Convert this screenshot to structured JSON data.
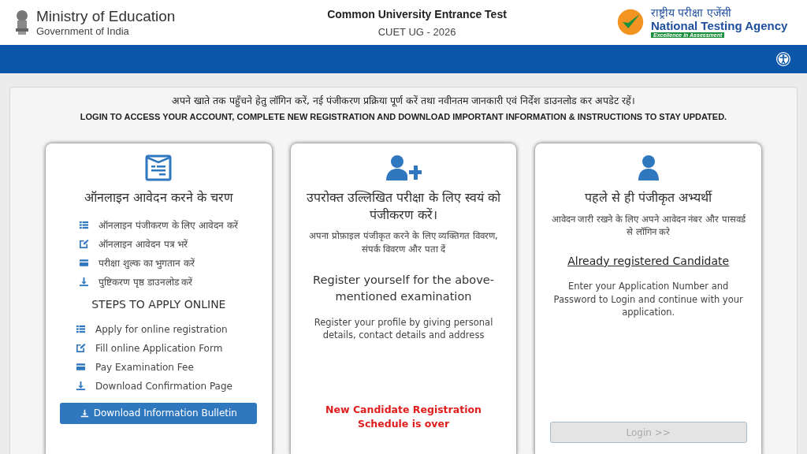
{
  "header": {
    "ministry": {
      "title": "Ministry of Education",
      "subtitle": "Government of India"
    },
    "exam": {
      "title": "Common University Entrance Test",
      "subtitle": "CUET UG - 2026"
    },
    "agency": {
      "hindi": "राष्ट्रीय परीक्षा एजेंसी",
      "name": "National Testing Agency",
      "tagline": "Excellence in Assessment"
    }
  },
  "notice": {
    "hindi": "अपने खाते तक पहुँचने हेतु लॉगिन करें, नई पंजीकरण प्रक्रिया पूर्ण करें तथा नवीनतम जानकारी एवं निर्देश डाउनलोड कर अपडेट रहें।",
    "english": "LOGIN TO ACCESS YOUR ACCOUNT, COMPLETE NEW REGISTRATION AND DOWNLOAD IMPORTANT INFORMATION & INSTRUCTIONS TO STAY UPDATED."
  },
  "steps_card": {
    "heading_hi": "ऑनलाइन आवेदन करने के चरण",
    "steps_hi": [
      {
        "kind": "list",
        "text": "ऑनलाइन पंजीकरण के लिए आवेदन करें"
      },
      {
        "kind": "edit",
        "text": "ऑनलाइन आवेदन पत्र भरें"
      },
      {
        "kind": "card",
        "text": "परीक्षा शुल्क का भुगतान करें"
      },
      {
        "kind": "download",
        "text": "पुष्टिकरण पृष्ठ डाउनलोड करें"
      }
    ],
    "heading_en": "STEPS TO APPLY ONLINE",
    "steps_en": [
      {
        "kind": "list",
        "text": "Apply for online registration"
      },
      {
        "kind": "edit",
        "text": "Fill online Application Form"
      },
      {
        "kind": "card",
        "text": "Pay Examination Fee"
      },
      {
        "kind": "download",
        "text": "Download Confirmation Page"
      }
    ],
    "button": "Download Information Bulletin"
  },
  "register_card": {
    "heading_hi": "उपरोक्त उल्लिखित परीक्षा के लिए स्वयं को पंजीकरण करें।",
    "text_hi": "अपना प्रोफ़ाइल पंजीकृत करने के लिए व्यक्तिगत विवरण, संपर्क विवरण और पता दें",
    "heading_en": "Register yourself for the above-mentioned examination",
    "text_en": "Register your profile by giving personal details, contact details and address",
    "notice": "New Candidate Registration Schedule is over"
  },
  "login_card": {
    "heading_hi": "पहले से ही पंजीकृत अभ्यर्थी",
    "text_hi": "आवेदन जारी रखने के लिए अपने आवेदन नंबर और पासवर्ड से लॉगिन करे",
    "link": "Already registered Candidate",
    "text_en": "Enter your Application Number and Password to Login and continue with your application.",
    "button": {
      "label": "Login >>",
      "disabled": true
    }
  }
}
